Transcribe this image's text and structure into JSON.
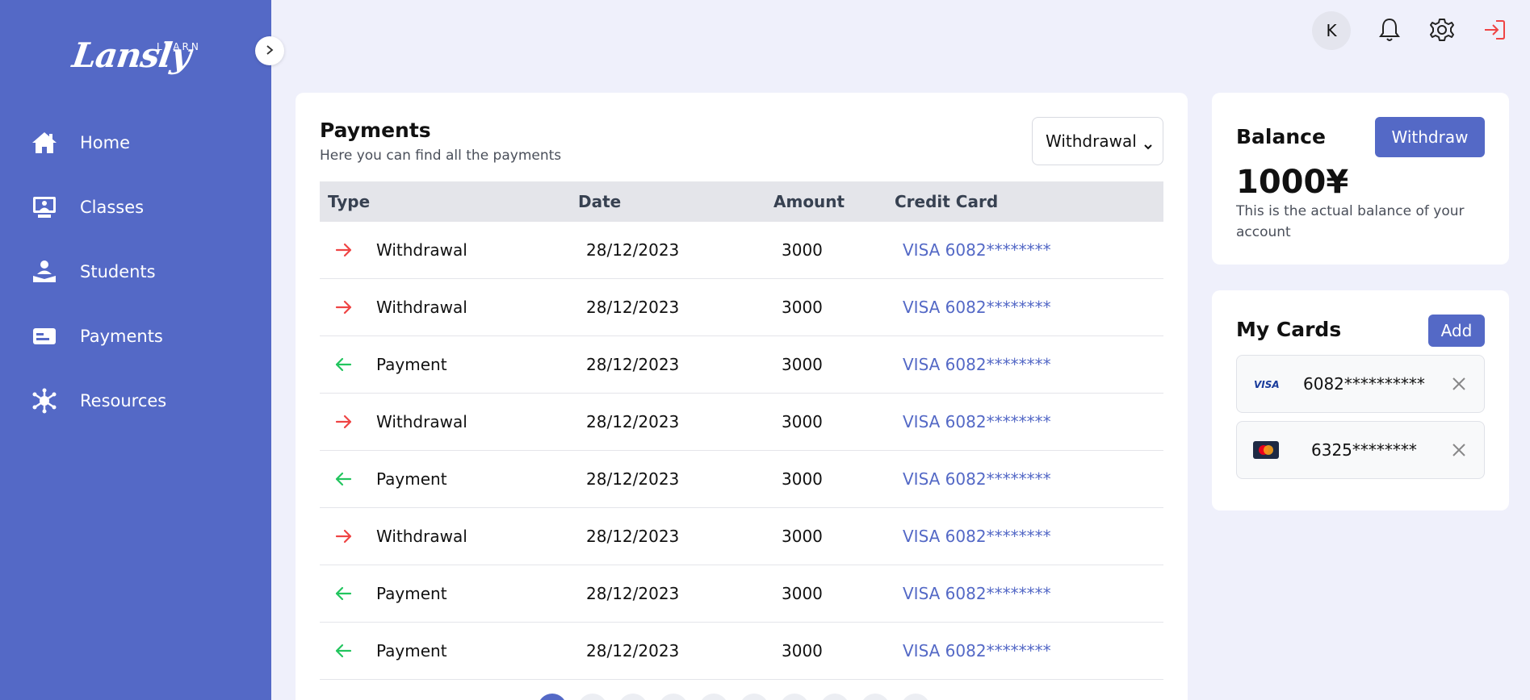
{
  "brand": {
    "name": "Lansly",
    "sub": "LEARN"
  },
  "sidebar": {
    "items": [
      {
        "label": "Home",
        "icon": "home-icon"
      },
      {
        "label": "Classes",
        "icon": "classroom-icon"
      },
      {
        "label": "Students",
        "icon": "student-icon"
      },
      {
        "label": "Payments",
        "icon": "card-icon"
      },
      {
        "label": "Resources",
        "icon": "resources-icon"
      }
    ]
  },
  "header": {
    "avatar_initial": "K"
  },
  "payments": {
    "title": "Payments",
    "subtitle": "Here you can find all the payments",
    "filter_value": "Withdrawal",
    "columns": [
      "Type",
      "Date",
      "Amount",
      "Credit Card"
    ],
    "rows": [
      {
        "type": "Withdrawal",
        "direction": "out",
        "date": "28/12/2023",
        "amount": "3000",
        "card": "VISA 6082********"
      },
      {
        "type": "Withdrawal",
        "direction": "out",
        "date": "28/12/2023",
        "amount": "3000",
        "card": "VISA 6082********"
      },
      {
        "type": "Payment",
        "direction": "in",
        "date": "28/12/2023",
        "amount": "3000",
        "card": "VISA 6082********"
      },
      {
        "type": "Withdrawal",
        "direction": "out",
        "date": "28/12/2023",
        "amount": "3000",
        "card": "VISA 6082********"
      },
      {
        "type": "Payment",
        "direction": "in",
        "date": "28/12/2023",
        "amount": "3000",
        "card": "VISA 6082********"
      },
      {
        "type": "Withdrawal",
        "direction": "out",
        "date": "28/12/2023",
        "amount": "3000",
        "card": "VISA 6082********"
      },
      {
        "type": "Payment",
        "direction": "in",
        "date": "28/12/2023",
        "amount": "3000",
        "card": "VISA 6082********"
      },
      {
        "type": "Payment",
        "direction": "in",
        "date": "28/12/2023",
        "amount": "3000",
        "card": "VISA 6082********"
      }
    ],
    "pages": 10
  },
  "balance": {
    "title": "Balance",
    "withdraw_label": "Withdraw",
    "amount": "1000¥",
    "description": "This is the actual balance of your account"
  },
  "cards": {
    "title": "My Cards",
    "add_label": "Add",
    "items": [
      {
        "brand": "VISA",
        "number": "6082**********"
      },
      {
        "brand": "MasterCard",
        "number": "6325********"
      }
    ]
  },
  "colors": {
    "accent": "#5469c6",
    "out_arrow": "#ef4444",
    "in_arrow": "#22c55e",
    "logout": "#ef4444"
  }
}
